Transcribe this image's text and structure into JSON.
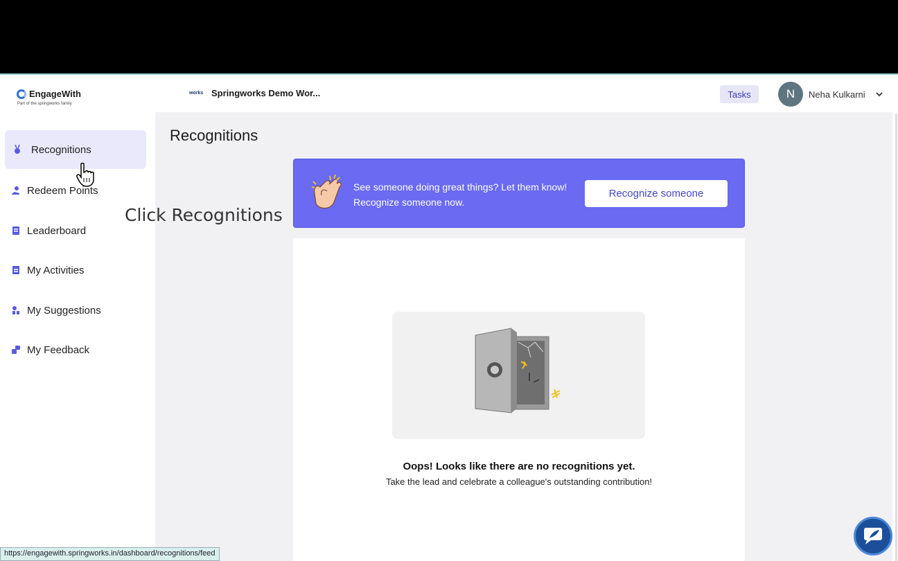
{
  "header": {
    "logo_text": "EngageWith",
    "logo_sub": "Part of the springworks family",
    "org_logo": "works",
    "org_name": "Springworks Demo Wor...",
    "tasks_label": "Tasks",
    "user_initial": "N",
    "user_name": "Neha Kulkarni"
  },
  "sidebar": {
    "items": [
      {
        "label": "Recognitions",
        "icon": "medal-icon"
      },
      {
        "label": "Redeem Points",
        "icon": "hand-coin-icon"
      },
      {
        "label": "Leaderboard",
        "icon": "leaderboard-icon"
      },
      {
        "label": "My Activities",
        "icon": "activities-icon"
      },
      {
        "label": "My Suggestions",
        "icon": "suggestions-icon"
      },
      {
        "label": "My Feedback",
        "icon": "feedback-icon"
      }
    ]
  },
  "main": {
    "title": "Recognitions",
    "banner": {
      "text": "See someone doing great things? Let them know! Recognize someone now.",
      "button_label": "Recognize someone"
    },
    "empty_state": {
      "title": "Oops! Looks like there are no recognitions yet.",
      "subtitle": "Take the lead and celebrate a colleague's outstanding contribution!"
    }
  },
  "overlay": {
    "callout": "Click Recognitions"
  },
  "status_bar": {
    "url": "https://engagewith.springworks.in/dashboard/recognitions/feed"
  },
  "colors": {
    "accent": "#6a6af2",
    "active_nav_bg": "#e9e9fb",
    "chat_bg": "#1b4f9a"
  }
}
